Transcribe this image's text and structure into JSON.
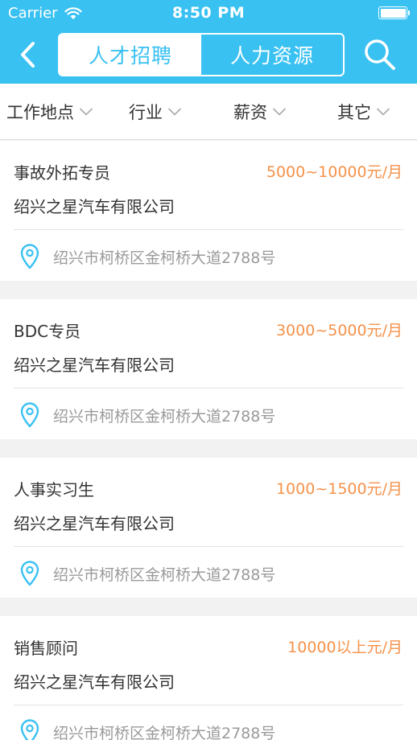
{
  "status_bar": {
    "carrier": "Carrier",
    "time": "8:50 PM"
  },
  "nav": {
    "tabs": [
      {
        "label": "人才招聘",
        "active": true
      },
      {
        "label": "人力资源",
        "active": false
      }
    ],
    "icons": {
      "back": "chevron-left-icon",
      "search": "search-icon"
    }
  },
  "filters": [
    {
      "label": "工作地点"
    },
    {
      "label": "行业"
    },
    {
      "label": "薪资"
    },
    {
      "label": "其它"
    }
  ],
  "jobs": [
    {
      "title": "事故外拓专员",
      "salary": "5000~10000元/月",
      "company": "绍兴之星汽车有限公司",
      "address": "绍兴市柯桥区金柯桥大道2788号"
    },
    {
      "title": "BDC专员",
      "salary": "3000~5000元/月",
      "company": "绍兴之星汽车有限公司",
      "address": "绍兴市柯桥区金柯桥大道2788号"
    },
    {
      "title": "人事实习生",
      "salary": "1000~1500元/月",
      "company": "绍兴之星汽车有限公司",
      "address": "绍兴市柯桥区金柯桥大道2788号"
    },
    {
      "title": "销售顾问",
      "salary": "10000以上元/月",
      "company": "绍兴之星汽车有限公司",
      "address": "绍兴市柯桥区金柯桥大道2788号"
    }
  ],
  "colors": {
    "brand": "#39c1f2",
    "salary": "#f5924a",
    "address": "#9a9a9a"
  }
}
